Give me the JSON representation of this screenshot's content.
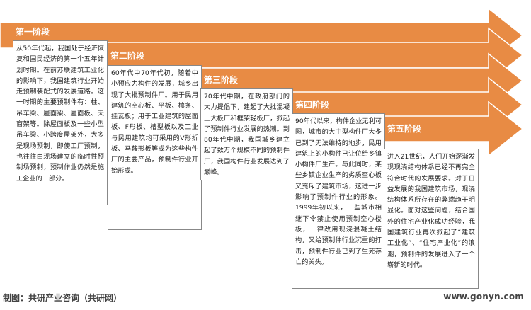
{
  "colors": {
    "arrow_fill": "#E88B44",
    "arrow_stroke": "#ffffff",
    "box_border": "#888888",
    "text": "#222222",
    "footer": "#444444"
  },
  "stages": [
    {
      "label": "第一阶段",
      "text": "从50年代起，我国处于经济恢复和国民经济的第一个五年计划时期。在前苏联建筑工业化的影响下，我国建筑行业开始走预制装配式的发展道路。这一时期的主要预制件有：柱、吊车梁、屋面梁、屋面板、天窗架等。除屋面板及一些小型吊车梁、小跨度屋架外，大多是现场预制，即使工厂预制，也往往由现场建立的临时性预制场预制，预制作业仍然是施工企业的一部分。"
    },
    {
      "label": "第二阶段",
      "text": "60年代中70年代初，随着中小预应力构件的发展，城乡出现了大批预制件厂。用于民用建筑的空心板、平板、檩条、挂瓦板；用于工业建筑的屋面板、F形板、槽型板以及工业与民用建筑均可采用的V形折板、马鞍形板等成为这些构件厂的主要产品，预制件行业开始形成。"
    },
    {
      "label": "第三阶段",
      "text": "70年代中期，在政府部门的大力提倡下，建起了大批混凝土大板厂和框架轻板厂，掀起了预制件行业发展的热潮。到80年代中期，我国城乡建立起了数万个规模不同的预制件厂，我国构件行业发展达到了巅峰。"
    },
    {
      "label": "第四阶段",
      "text": "90年代以来，构件企业无利可图，城市的大中型构件厂大多已到了无法维持的地步，民用建筑上的小构件已让位给乡镇小构件厂生产。与此同时，某些乡镇企业生产的劣质空心板又充斥了建筑市场，这进一步影响了预制件行业的形象。1999年初以来，一些城市相继下令禁止使用预制空心楼板，一律改用现浇混凝土结构，又给预制件行业沉重的打击，预制件行业已到了生死存亡的关头。"
    },
    {
      "label": "第五阶段",
      "text": "进入21世纪，人们开始逐渐发现现浇结构体系已经不再完全符合时代的发展要求。对于日益发展的我国建筑市场，现浇结构体系所存在的弊端趋于明显化。面对这些问题，结合国外的住宅产业化成功经验，我国建筑行业再次掀起了“建筑工业化”、“住宅产业化”的浪潮，预制件的发展进入了一个崭新的时代。"
    }
  ],
  "footer": {
    "source": "制图：共研产业咨询（共研网）",
    "url": "www.gonyn.com"
  }
}
